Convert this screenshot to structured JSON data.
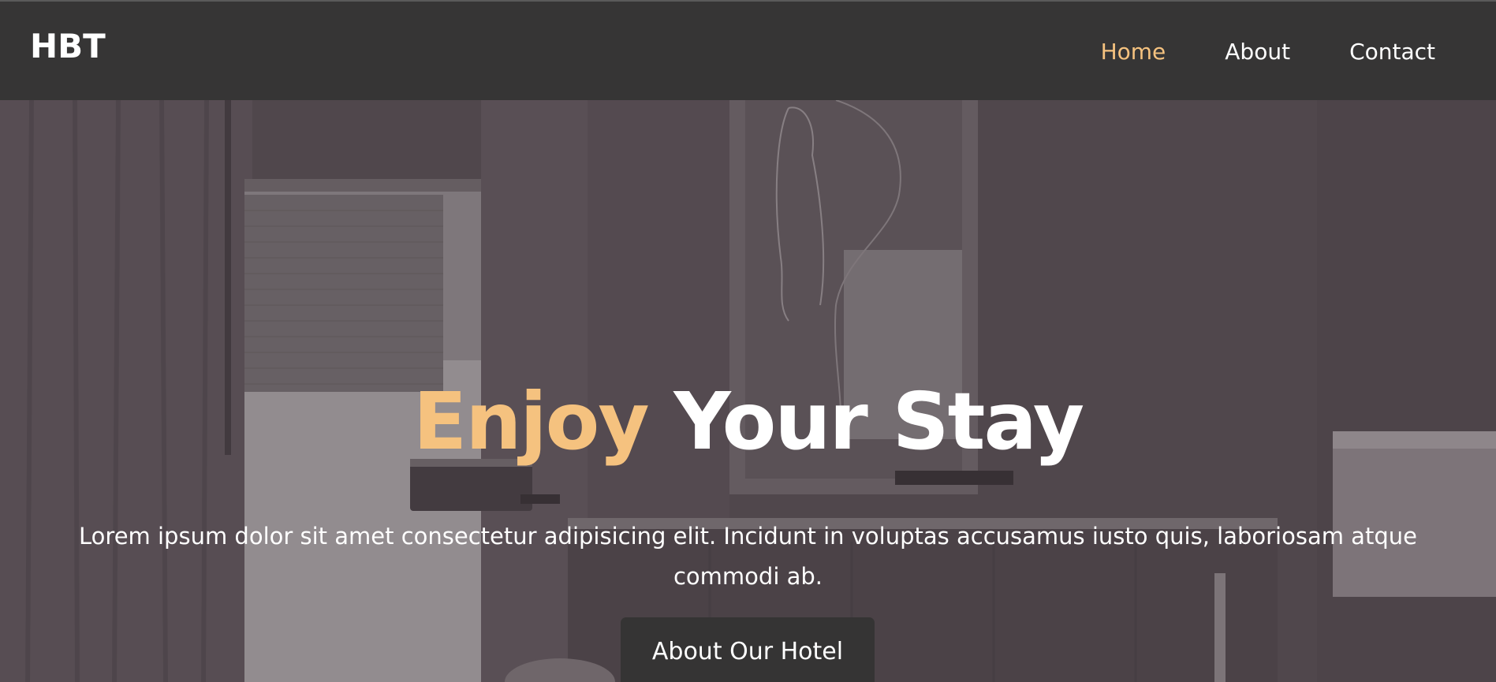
{
  "navbar": {
    "brand": "HBT",
    "links": [
      {
        "label": "Home",
        "active": true
      },
      {
        "label": "About",
        "active": false
      },
      {
        "label": "Contact",
        "active": false
      }
    ]
  },
  "hero": {
    "title_accent": "Enjoy",
    "title_rest": "Your Stay",
    "text": "Lorem ipsum dolor sit amet consectetur adipisicing elit. Incidunt in voluptas accusamus iusto quis, laboriosam atque commodi ab.",
    "button_label": "About Our Hotel"
  },
  "colors": {
    "navbar_bg": "#363535",
    "accent": "#f5c27f",
    "hero_tint": "#4f474c",
    "button_bg": "#353434",
    "text": "#ffffff"
  }
}
